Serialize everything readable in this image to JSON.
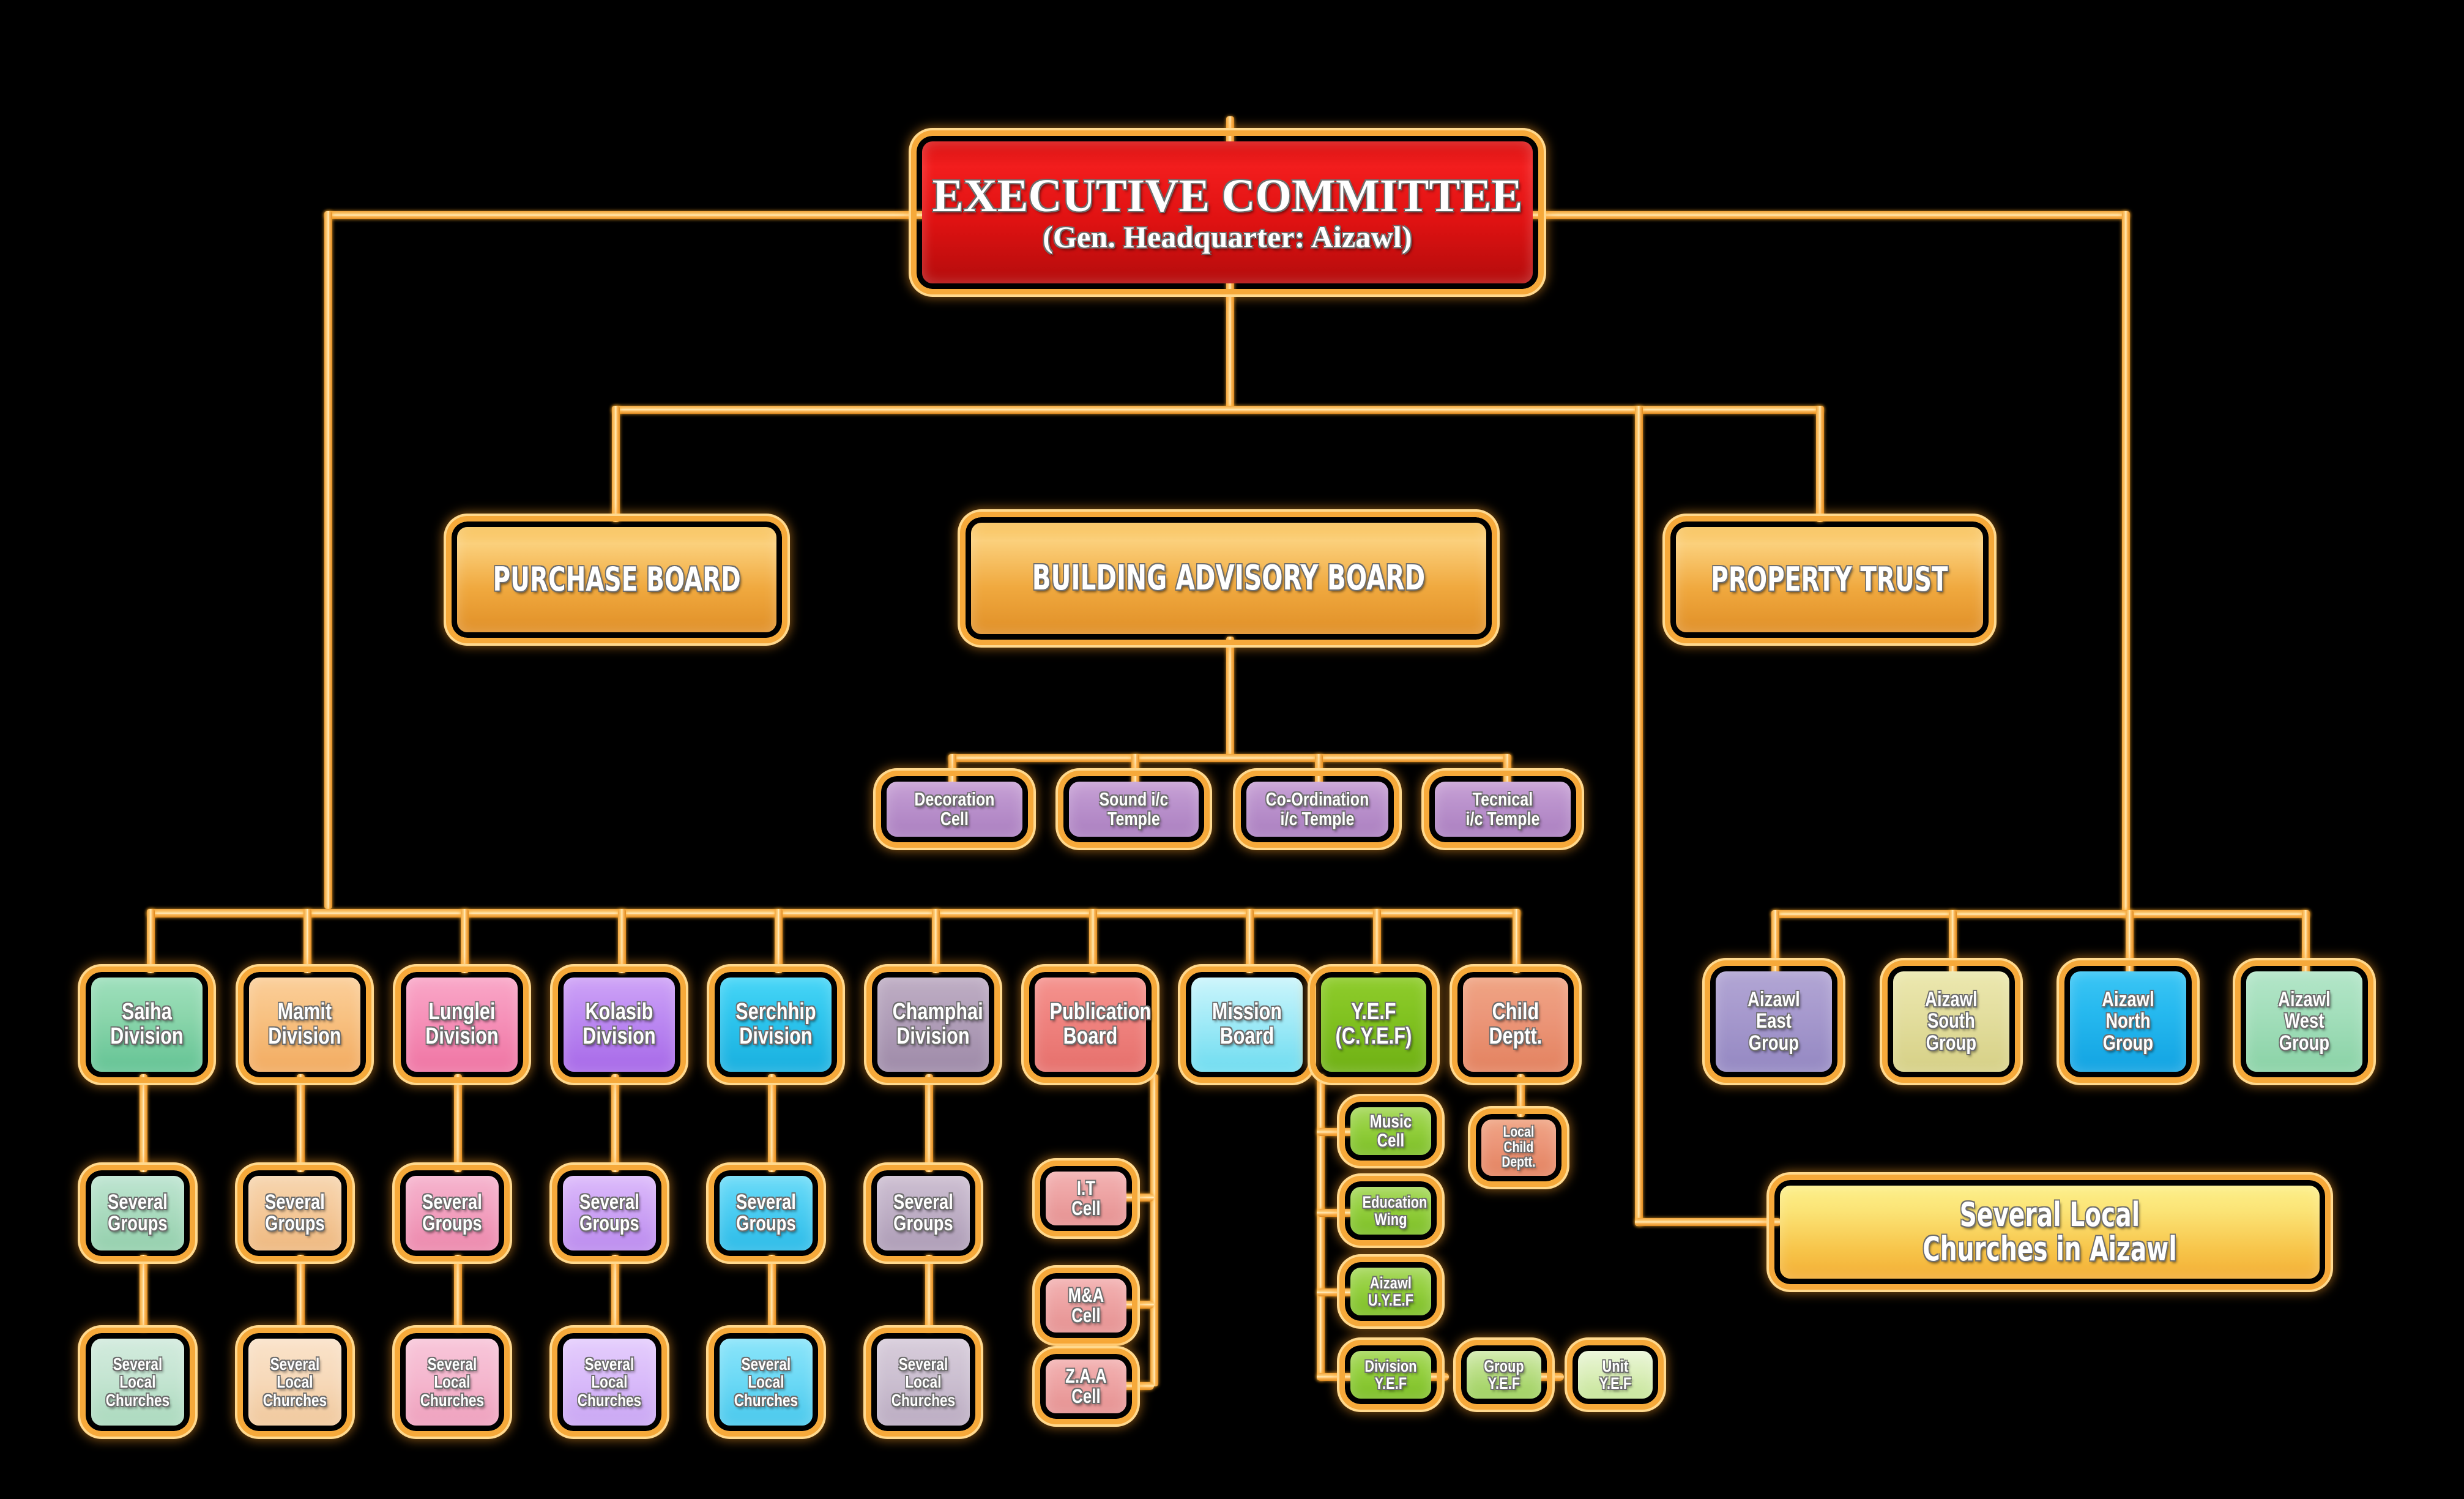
{
  "chart_data": {
    "type": "diagram",
    "title": "Executive Committee Organisational Chart",
    "nodes": [
      {
        "id": "exec",
        "label": "EXECUTIVE COMMITTEE",
        "sublabel": "(Gen. Headquarter: Aizawl)",
        "color": "#e01212",
        "level": 0
      },
      {
        "id": "purchase",
        "label": "PURCHASE BOARD",
        "color": "#f0a93f",
        "level": 1
      },
      {
        "id": "building",
        "label": "BUILDING ADVISORY BOARD",
        "color": "#f0a93f",
        "level": 1
      },
      {
        "id": "property",
        "label": "PROPERTY TRUST",
        "color": "#f0a93f",
        "level": 1
      },
      {
        "id": "decoration",
        "label": "Decoration Cell",
        "color": "#bb93cd",
        "level": 2
      },
      {
        "id": "sound",
        "label": "Sound i/c Temple",
        "color": "#bb93cd",
        "level": 2
      },
      {
        "id": "coord",
        "label": "Co-Ordination i/c Temple",
        "color": "#bb93cd",
        "level": 2
      },
      {
        "id": "tecnical",
        "label": "Tecnical i/c Temple",
        "color": "#bb93cd",
        "level": 2
      },
      {
        "id": "saiha",
        "label": "Saiha Division",
        "color": "#8cd6ac",
        "level": 2
      },
      {
        "id": "mamit",
        "label": "Mamit Division",
        "color": "#f8c283",
        "level": 2
      },
      {
        "id": "lunglei",
        "label": "Lunglei Division",
        "color": "#f693ba",
        "level": 2
      },
      {
        "id": "kolasib",
        "label": "Kolasib Division",
        "color": "#bd8cf2",
        "level": 2
      },
      {
        "id": "serchhip",
        "label": "Serchhip Division",
        "color": "#2fc6ee",
        "level": 2
      },
      {
        "id": "champhai",
        "label": "Champhai Division",
        "color": "#b2a0ba",
        "level": 2
      },
      {
        "id": "publication",
        "label": "Publication Board",
        "color": "#f08480",
        "level": 2
      },
      {
        "id": "mission",
        "label": "Mission Board",
        "color": "#a7ecf8",
        "level": 2
      },
      {
        "id": "yef",
        "label": "Y.E.F (C.Y.E.F)",
        "color": "#82c321",
        "level": 2
      },
      {
        "id": "child",
        "label": "Child Deptt.",
        "color": "#ec977a",
        "level": 2
      },
      {
        "id": "aizawl-east",
        "label": "Aizawl East Group",
        "color": "#a79ace",
        "level": 2
      },
      {
        "id": "aizawl-south",
        "label": "Aizawl South Group",
        "color": "#e4dfa0",
        "level": 2
      },
      {
        "id": "aizawl-north",
        "label": "Aizawl North Group",
        "color": "#26b9ef",
        "level": 2
      },
      {
        "id": "aizawl-west",
        "label": "Aizawl West Group",
        "color": "#a4dfbc",
        "level": 2
      },
      {
        "id": "aizawl-churches",
        "label": "Several Local Churches in Aizawl",
        "color": "#f7c449",
        "level": 3
      }
    ],
    "edges": [
      {
        "from": "exec",
        "to": "purchase"
      },
      {
        "from": "exec",
        "to": "building"
      },
      {
        "from": "exec",
        "to": "property"
      },
      {
        "from": "exec",
        "to": "divisions-bus"
      },
      {
        "from": "building",
        "to": "decoration"
      },
      {
        "from": "building",
        "to": "sound"
      },
      {
        "from": "building",
        "to": "coord"
      },
      {
        "from": "building",
        "to": "tecnical"
      },
      {
        "from": "property",
        "to": "aizawl-groups-bus"
      },
      {
        "from": "property",
        "to": "aizawl-churches"
      }
    ]
  },
  "root": {
    "title": "EXECUTIVE COMMITTEE",
    "subtitle": "(Gen. Headquarter: Aizawl)"
  },
  "boards": {
    "purchase": "PURCHASE BOARD",
    "building": "BUILDING ADVISORY BOARD",
    "property": "PROPERTY TRUST"
  },
  "building_cells": [
    {
      "line1": "Decoration",
      "line2": "Cell"
    },
    {
      "line1": "Sound i/c",
      "line2": "Temple"
    },
    {
      "line1": "Co-Ordination",
      "line2": "i/c Temple"
    },
    {
      "line1": "Tecnical",
      "line2": "i/c Temple"
    }
  ],
  "divisions": [
    {
      "line1": "Saiha",
      "line2": "Division"
    },
    {
      "line1": "Mamit",
      "line2": "Division"
    },
    {
      "line1": "Lunglei",
      "line2": "Division"
    },
    {
      "line1": "Kolasib",
      "line2": "Division"
    },
    {
      "line1": "Serchhip",
      "line2": "Division"
    },
    {
      "line1": "Champhai",
      "line2": "Division"
    },
    {
      "line1": "Publication",
      "line2": "Board"
    },
    {
      "line1": "Mission",
      "line2": "Board"
    },
    {
      "line1": "Y.E.F",
      "line2": "(C.Y.E.F)"
    },
    {
      "line1": "Child",
      "line2": "Deptt."
    }
  ],
  "groups_row": {
    "line1": "Several",
    "line2": "Groups",
    "count": 6
  },
  "churches_row": {
    "line1": "Several",
    "line2": "Local",
    "line3": "Churches",
    "count": 6
  },
  "publication_cells": [
    {
      "line1": "I.T",
      "line2": "Cell"
    },
    {
      "line1": "M&A",
      "line2": "Cell"
    },
    {
      "line1": "Z.A.A",
      "line2": "Cell"
    }
  ],
  "yef_cells": [
    {
      "line1": "Music",
      "line2": "Cell"
    },
    {
      "line1": "Education",
      "line2": "Wing"
    },
    {
      "line1": "Aizawl",
      "line2": "U.Y.E.F"
    },
    {
      "line1": "Division",
      "line2": "Y.E.F"
    }
  ],
  "yef_chain": [
    {
      "line1": "Division",
      "line2": "Y.E.F"
    },
    {
      "line1": "Group",
      "line2": "Y.E.F"
    },
    {
      "line1": "Unit",
      "line2": "Y.E.F"
    }
  ],
  "child_cell": {
    "line1": "Local",
    "line2": "Child",
    "line3": "Deptt."
  },
  "aizawl_groups": [
    {
      "line1": "Aizawl",
      "line2": "East",
      "line3": "Group"
    },
    {
      "line1": "Aizawl",
      "line2": "South",
      "line3": "Group"
    },
    {
      "line1": "Aizawl",
      "line2": "North",
      "line3": "Group"
    },
    {
      "line1": "Aizawl",
      "line2": "West",
      "line3": "Group"
    }
  ],
  "aizawl_churches": {
    "line1": "Several Local",
    "line2": "Churches  in  Aizawl"
  },
  "colors": {
    "background": "#000000",
    "connector": "#f6a93a",
    "frame": "#f6a93a",
    "root": "#e01212",
    "board": "#f0a93f",
    "building_cell": "#bb93cd",
    "saiha": "#8cd6ac",
    "mamit": "#f8c283",
    "lunglei": "#f693ba",
    "kolasib": "#bd8cf2",
    "serchhip": "#2fc6ee",
    "champhai": "#b2a0ba",
    "publication": "#f08480",
    "mission": "#a7ecf8",
    "yef": "#82c321",
    "child": "#ec977a",
    "aizawl_east": "#a79ace",
    "aizawl_south": "#e4dfa0",
    "aizawl_north": "#26b9ef",
    "aizawl_west": "#a4dfbc",
    "aizawl_churches": "#f7c449"
  }
}
